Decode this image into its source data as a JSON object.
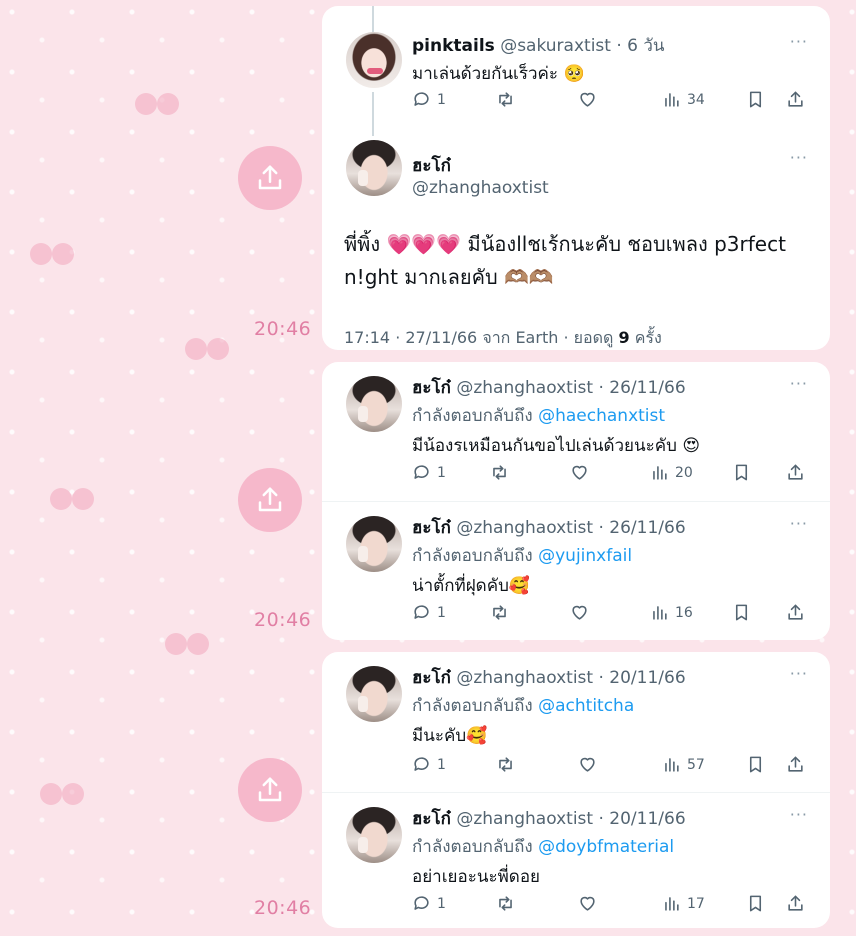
{
  "times": [
    "20:46",
    "20:46",
    "20:46"
  ],
  "parent_tweet": {
    "name": "pinktails",
    "handle": "@sakuraxtist",
    "age": "6 วัน",
    "text": "มาเล่นด้วยกันเร็วค่ะ 🥺",
    "replies": "1",
    "views": "34"
  },
  "main_tweet": {
    "name": "ฮะโก๋",
    "handle": "@zhanghaoxtist",
    "text_line1": "พี่พิ้ง 💗💗💗 มีน้องllชเร้กนะคับ ชอบเพลง p3rfect",
    "text_line2": "n!ght มากเลยคับ 🫶🏽🫶🏽",
    "timestamp": "17:14 · 27/11/66 จาก Earth · ยอดดู",
    "view_count": "9",
    "view_unit": "ครั้ง"
  },
  "replies": [
    {
      "name": "ฮะโก๋",
      "handle": "@zhanghaoxtist",
      "date": "26/11/66",
      "reply_prefix": "กำลังตอบกลับถึง",
      "mention": "@haechanxtist",
      "text": "มีน้องรเหมือนกันขอไปเล่นด้วยนะคับ 😍",
      "replies": "1",
      "views": "20"
    },
    {
      "name": "ฮะโก๋",
      "handle": "@zhanghaoxtist",
      "date": "26/11/66",
      "reply_prefix": "กำลังตอบกลับถึง",
      "mention": "@yujinxfail",
      "text": "น่าตั้กที่ฝุดคับ🥰",
      "replies": "1",
      "views": "16"
    },
    {
      "name": "ฮะโก๋",
      "handle": "@zhanghaoxtist",
      "date": "20/11/66",
      "reply_prefix": "กำลังตอบกลับถึง",
      "mention": "@achtitcha",
      "text": "มีนะคับ🥰",
      "replies": "1",
      "views": "57"
    },
    {
      "name": "ฮะโก๋",
      "handle": "@zhanghaoxtist",
      "date": "20/11/66",
      "reply_prefix": "กำลังตอบกลับถึง",
      "mention": "@doybfmaterial",
      "text": "อย่าเยอะนะพี่ดอย",
      "replies": "1",
      "views": "17"
    }
  ],
  "more_label": "···",
  "colors": {
    "background": "#fbe4ea",
    "share_button": "#f6b8cb",
    "time_text": "#e17fa4",
    "mention": "#1d9bf0"
  },
  "icons": [
    "share-icon",
    "reply-icon",
    "retweet-icon",
    "like-icon",
    "views-icon",
    "bookmark-icon",
    "more-icon"
  ]
}
